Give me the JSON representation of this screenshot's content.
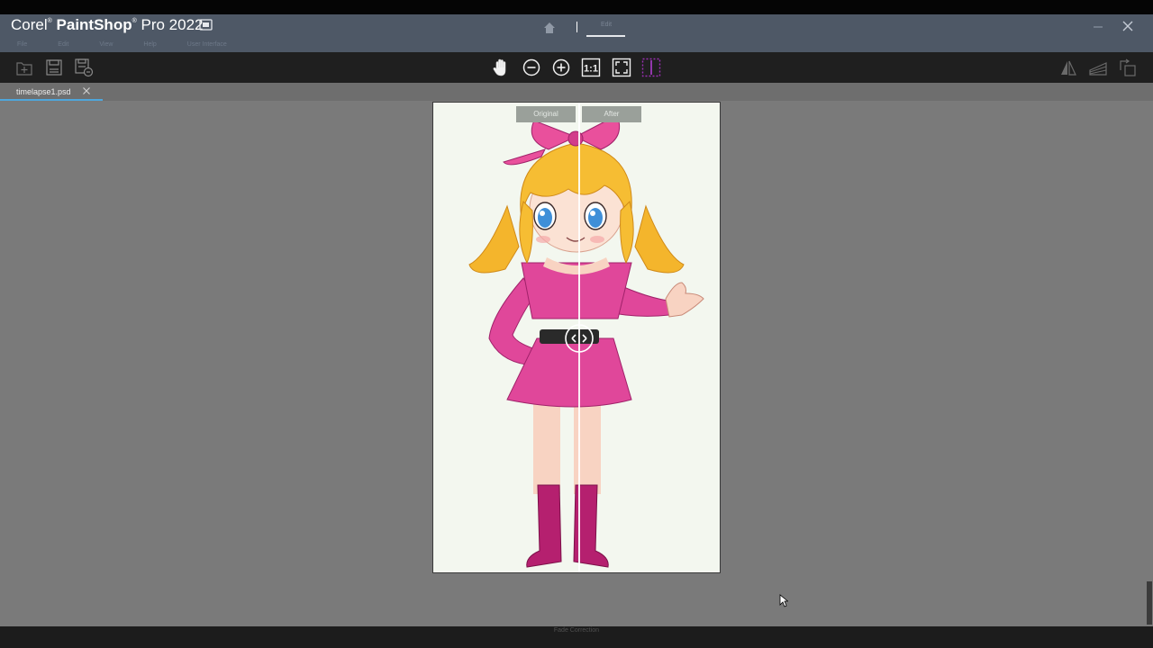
{
  "app": {
    "title_prefix": "Corel",
    "title_reg": "®",
    "title_brand": "PaintShop",
    "title_reg2": "®",
    "title_suffix": "Pro 2022"
  },
  "menu": [
    "File",
    "Edit",
    "View",
    "Help",
    "User Interface"
  ],
  "workspace_tabs": {
    "home_icon": "home-icon",
    "active": "Edit"
  },
  "toolbar": {
    "left_icons": [
      "new-file-icon",
      "save-icon",
      "save-as-icon"
    ],
    "center_icons": [
      "pan-hand-icon",
      "zoom-out-icon",
      "zoom-in-icon",
      "actual-size-icon",
      "fit-window-icon",
      "compare-split-icon"
    ],
    "actual_size_label": "1:1",
    "right_icons": [
      "flip-icon",
      "straighten-icon",
      "rotate-icon"
    ]
  },
  "document": {
    "tab_label": "timelapse1.psd"
  },
  "compare": {
    "original_label": "Original",
    "after_label": "After"
  },
  "status": {
    "text": "Fade Correction"
  },
  "colors": {
    "titlebar": "#4e5866",
    "toolbar": "#1f1f1f",
    "workspace": "#7a7a7a",
    "accent_tab": "#4ea6dc",
    "compare_icon": "#9b2fb5",
    "dress_pink": "#e0479a"
  }
}
